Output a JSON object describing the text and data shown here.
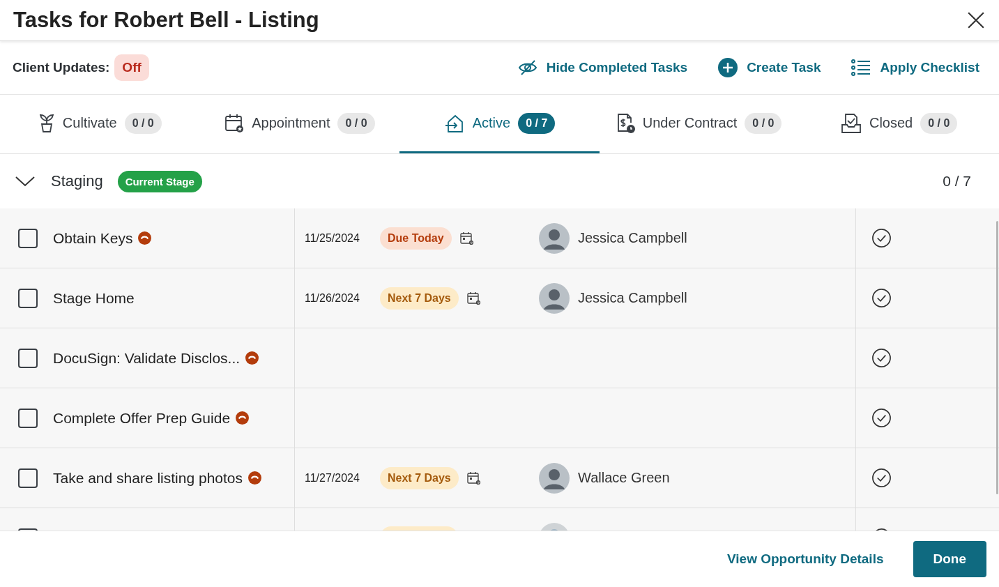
{
  "window": {
    "title": "Tasks for Robert Bell - Listing"
  },
  "toolbar": {
    "client_updates": {
      "label": "Client Updates:",
      "value": "Off",
      "on": false
    },
    "actions": [
      {
        "label": "Hide Completed Tasks"
      },
      {
        "label": "Create Task"
      },
      {
        "label": "Apply Checklist"
      }
    ]
  },
  "tabs": [
    {
      "label": "Cultivate",
      "count": "0 / 0",
      "selected": false
    },
    {
      "label": "Appointment",
      "count": "0 / 0",
      "selected": false
    },
    {
      "label": "Active",
      "count": "0 / 7",
      "selected": true
    },
    {
      "label": "Under Contract",
      "count": "0 / 0",
      "selected": false
    },
    {
      "label": "Closed",
      "count": "0 / 0",
      "selected": false
    }
  ],
  "stage": {
    "title": "Staging",
    "badge": "Current Stage",
    "count": "0 / 7",
    "expanded": true
  },
  "tasks": [
    {
      "title": "Obtain Keys",
      "checked": false,
      "priority": true,
      "due_date": "11/25/2024",
      "badge": {
        "label": "Due Today",
        "kind": "today"
      },
      "assignee": {
        "name": "Jessica Campbell",
        "kind": "photo"
      }
    },
    {
      "title": "Stage Home",
      "checked": false,
      "priority": false,
      "due_date": "11/26/2024",
      "badge": {
        "label": "Next 7 Days",
        "kind": "week"
      },
      "assignee": {
        "name": "Jessica Campbell",
        "kind": "photo"
      }
    },
    {
      "title": "DocuSign: Validate Disclos...",
      "checked": false,
      "priority": true
    },
    {
      "title": "Complete Offer Prep Guide",
      "checked": false,
      "priority": true
    },
    {
      "title": "Take and share listing photos",
      "checked": false,
      "priority": true,
      "due_date": "11/27/2024",
      "badge": {
        "label": "Next 7 Days",
        "kind": "week"
      },
      "assignee": {
        "name": "Wallace Green",
        "kind": "photo"
      }
    },
    {
      "checked": false,
      "badge": {
        "kind": "week"
      },
      "assignee": {
        "kind": "generic"
      }
    }
  ],
  "footer": {
    "link": "View Opportunity Details",
    "button": "Done"
  }
}
